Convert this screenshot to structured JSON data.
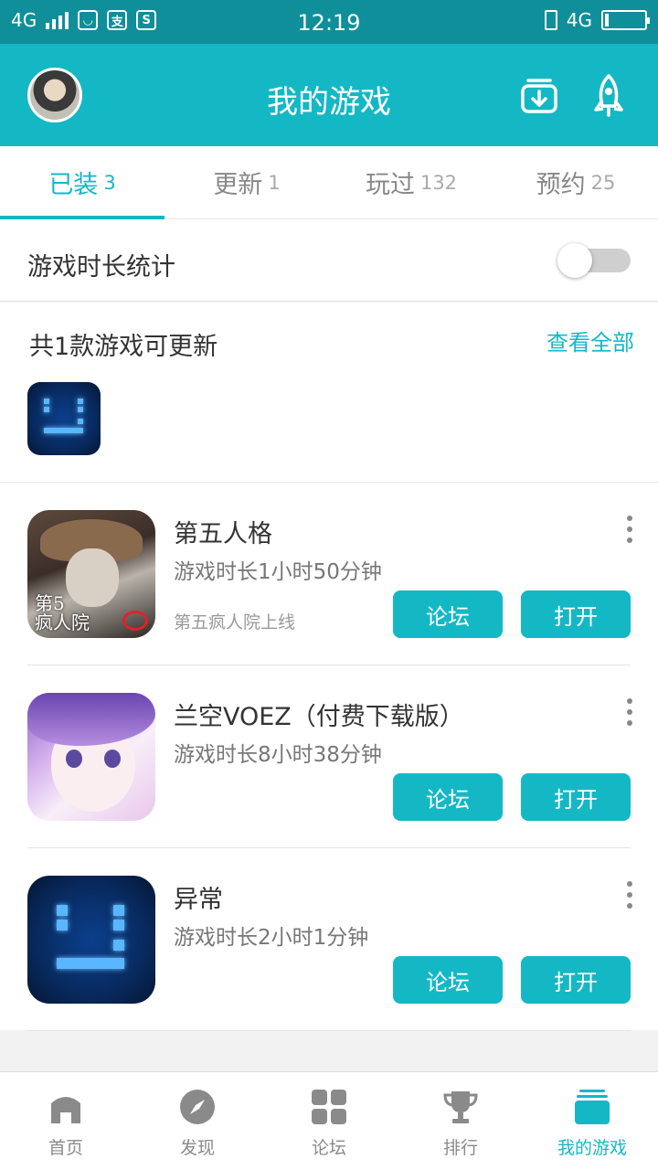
{
  "status_bar": {
    "network_left": "4G",
    "time": "12:19",
    "network_right": "4G"
  },
  "header": {
    "title": "我的游戏",
    "avatar_icon": "user-avatar",
    "download_icon": "download-box-icon",
    "rocket_icon": "rocket-icon"
  },
  "tabs": [
    {
      "label": "已装",
      "count": "3",
      "active": true
    },
    {
      "label": "更新",
      "count": "1",
      "active": false
    },
    {
      "label": "玩过",
      "count": "132",
      "active": false
    },
    {
      "label": "预约",
      "count": "25",
      "active": false
    }
  ],
  "stats": {
    "label": "游戏时长统计",
    "toggle_on": false
  },
  "updates": {
    "title": "共1款游戏可更新",
    "view_all": "查看全部"
  },
  "games": [
    {
      "name": "第五人格",
      "playtime": "游戏时长1小时50分钟",
      "note": "第五疯人院上线",
      "icon_text_1": "第5",
      "icon_text_2": "疯人院",
      "forum_label": "论坛",
      "open_label": "打开"
    },
    {
      "name": "兰空VOEZ（付费下载版）",
      "playtime": "游戏时长8小时38分钟",
      "forum_label": "论坛",
      "open_label": "打开"
    },
    {
      "name": "异常",
      "playtime": "游戏时长2小时1分钟",
      "forum_label": "论坛",
      "open_label": "打开"
    }
  ],
  "bottom_nav": [
    {
      "label": "首页",
      "icon": "home-icon",
      "active": false
    },
    {
      "label": "发现",
      "icon": "compass-icon",
      "active": false
    },
    {
      "label": "论坛",
      "icon": "grid-icon",
      "active": false
    },
    {
      "label": "排行",
      "icon": "trophy-icon",
      "active": false
    },
    {
      "label": "我的游戏",
      "icon": "stack-icon",
      "active": true
    }
  ],
  "colors": {
    "accent": "#14b8c5",
    "status_bar": "#0f8f9a",
    "nav_inactive": "#8a8a8a"
  }
}
